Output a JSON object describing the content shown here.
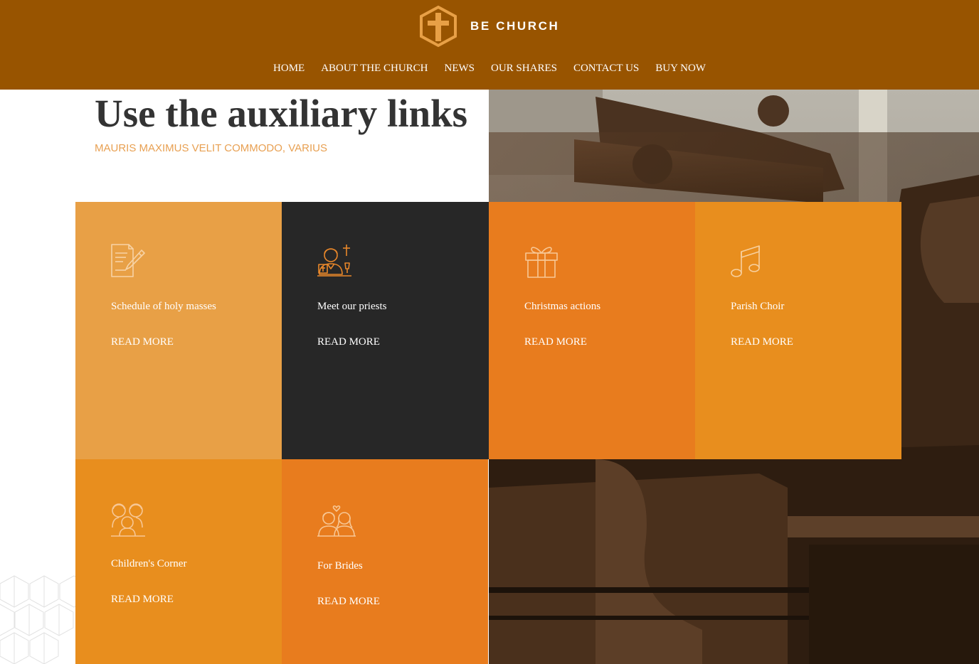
{
  "brand": {
    "name": "BE CHURCH",
    "logo_icon": "cross-hexagon-icon"
  },
  "nav": {
    "items": [
      {
        "label": "HOME"
      },
      {
        "label": "ABOUT THE CHURCH"
      },
      {
        "label": "NEWS"
      },
      {
        "label": "OUR SHARES"
      },
      {
        "label": "CONTACT US"
      },
      {
        "label": "BUY NOW"
      }
    ]
  },
  "hero": {
    "title": "Use the auxiliary links",
    "subtitle": "MAURIS MAXIMUS VELIT COMMODO, VARIUS"
  },
  "cards": [
    {
      "title": "Schedule of holy masses",
      "link_label": "READ MORE",
      "icon": "document-pen-icon",
      "bg_color": "#e8a046"
    },
    {
      "title": "Meet our priests",
      "link_label": "READ MORE",
      "icon": "priest-icon",
      "bg_color": "#272727"
    },
    {
      "title": "Christmas actions",
      "link_label": "READ MORE",
      "icon": "gift-icon",
      "bg_color": "#e87c1e"
    },
    {
      "title": "Parish Choir",
      "link_label": "READ MORE",
      "icon": "music-note-icon",
      "bg_color": "#e88e1e"
    },
    {
      "title": "Children's Corner",
      "link_label": "READ MORE",
      "icon": "children-icon",
      "bg_color": "#e88e1e"
    },
    {
      "title": "For Brides",
      "link_label": "READ MORE",
      "icon": "couple-icon",
      "bg_color": "#e87c1e"
    }
  ],
  "colors": {
    "header_bg": "#985400",
    "accent": "#e8a052",
    "icon_light": "#f2c48f",
    "icon_orange": "#e8872a"
  }
}
